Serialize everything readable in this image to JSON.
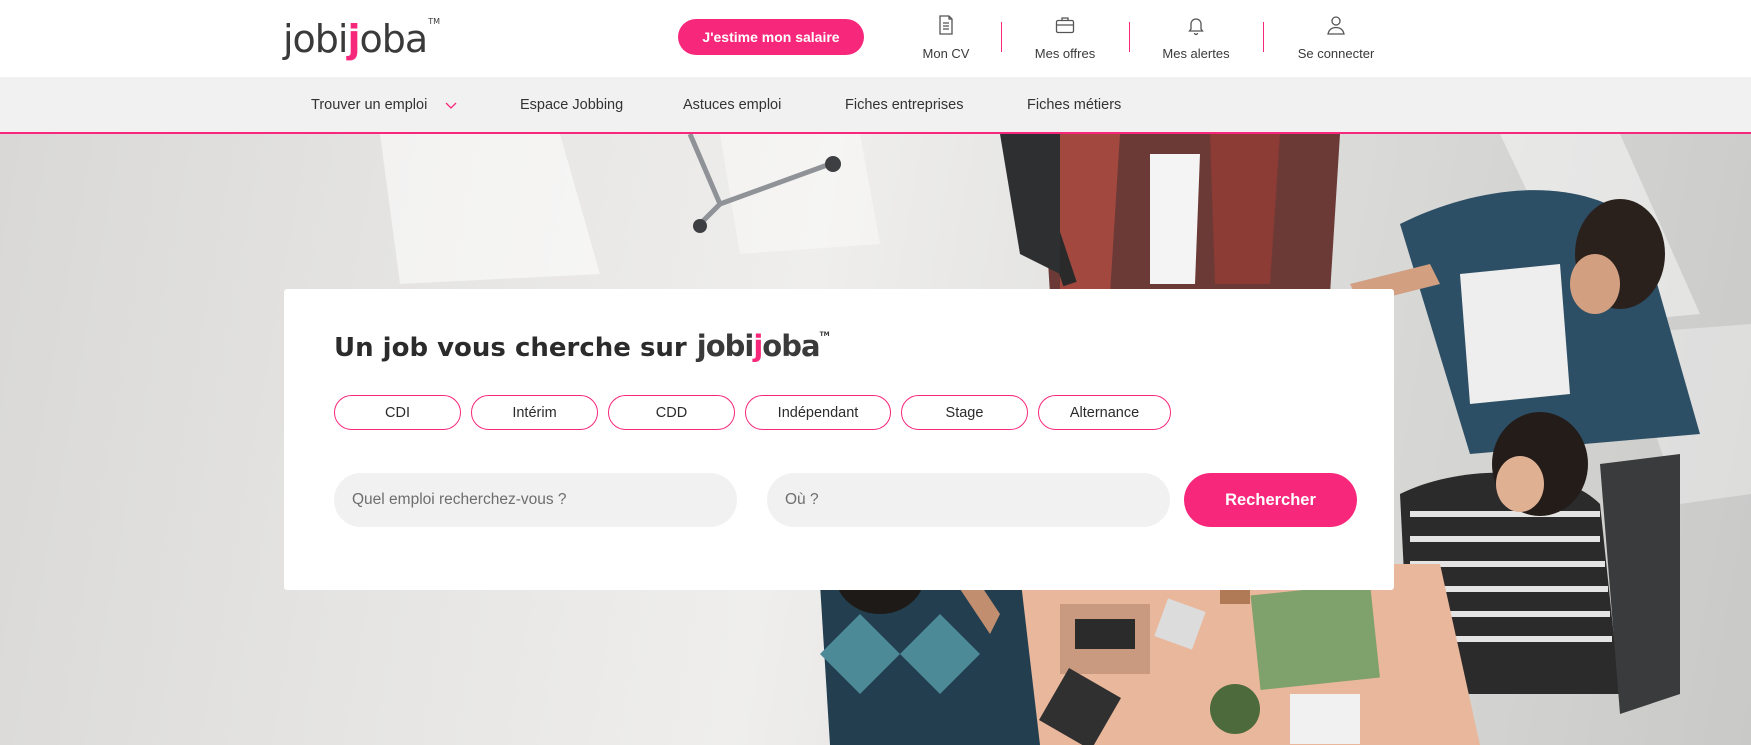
{
  "brand": {
    "logo_pre": "jobi",
    "logo_ij": "j",
    "logo_post": "oba",
    "tm": "TM",
    "accent": "#f7287b"
  },
  "header": {
    "salary_button": "J'estime mon salaire",
    "items": [
      {
        "label": "Mon CV",
        "icon": "document-icon"
      },
      {
        "label": "Mes offres",
        "icon": "briefcase-icon"
      },
      {
        "label": "Mes alertes",
        "icon": "bell-icon"
      },
      {
        "label": "Se connecter",
        "icon": "user-icon"
      }
    ]
  },
  "nav": {
    "items": [
      {
        "label": "Trouver un emploi",
        "has_dropdown": true
      },
      {
        "label": "Espace Jobbing"
      },
      {
        "label": "Astuces emploi"
      },
      {
        "label": "Fiches entreprises"
      },
      {
        "label": "Fiches métiers"
      }
    ]
  },
  "search": {
    "title": "Un job vous cherche sur",
    "contract_types": [
      "CDI",
      "Intérim",
      "CDD",
      "Indépendant",
      "Stage",
      "Alternance"
    ],
    "what_placeholder": "Quel emploi recherchez-vous ?",
    "where_placeholder": "Où ?",
    "submit_label": "Rechercher"
  }
}
